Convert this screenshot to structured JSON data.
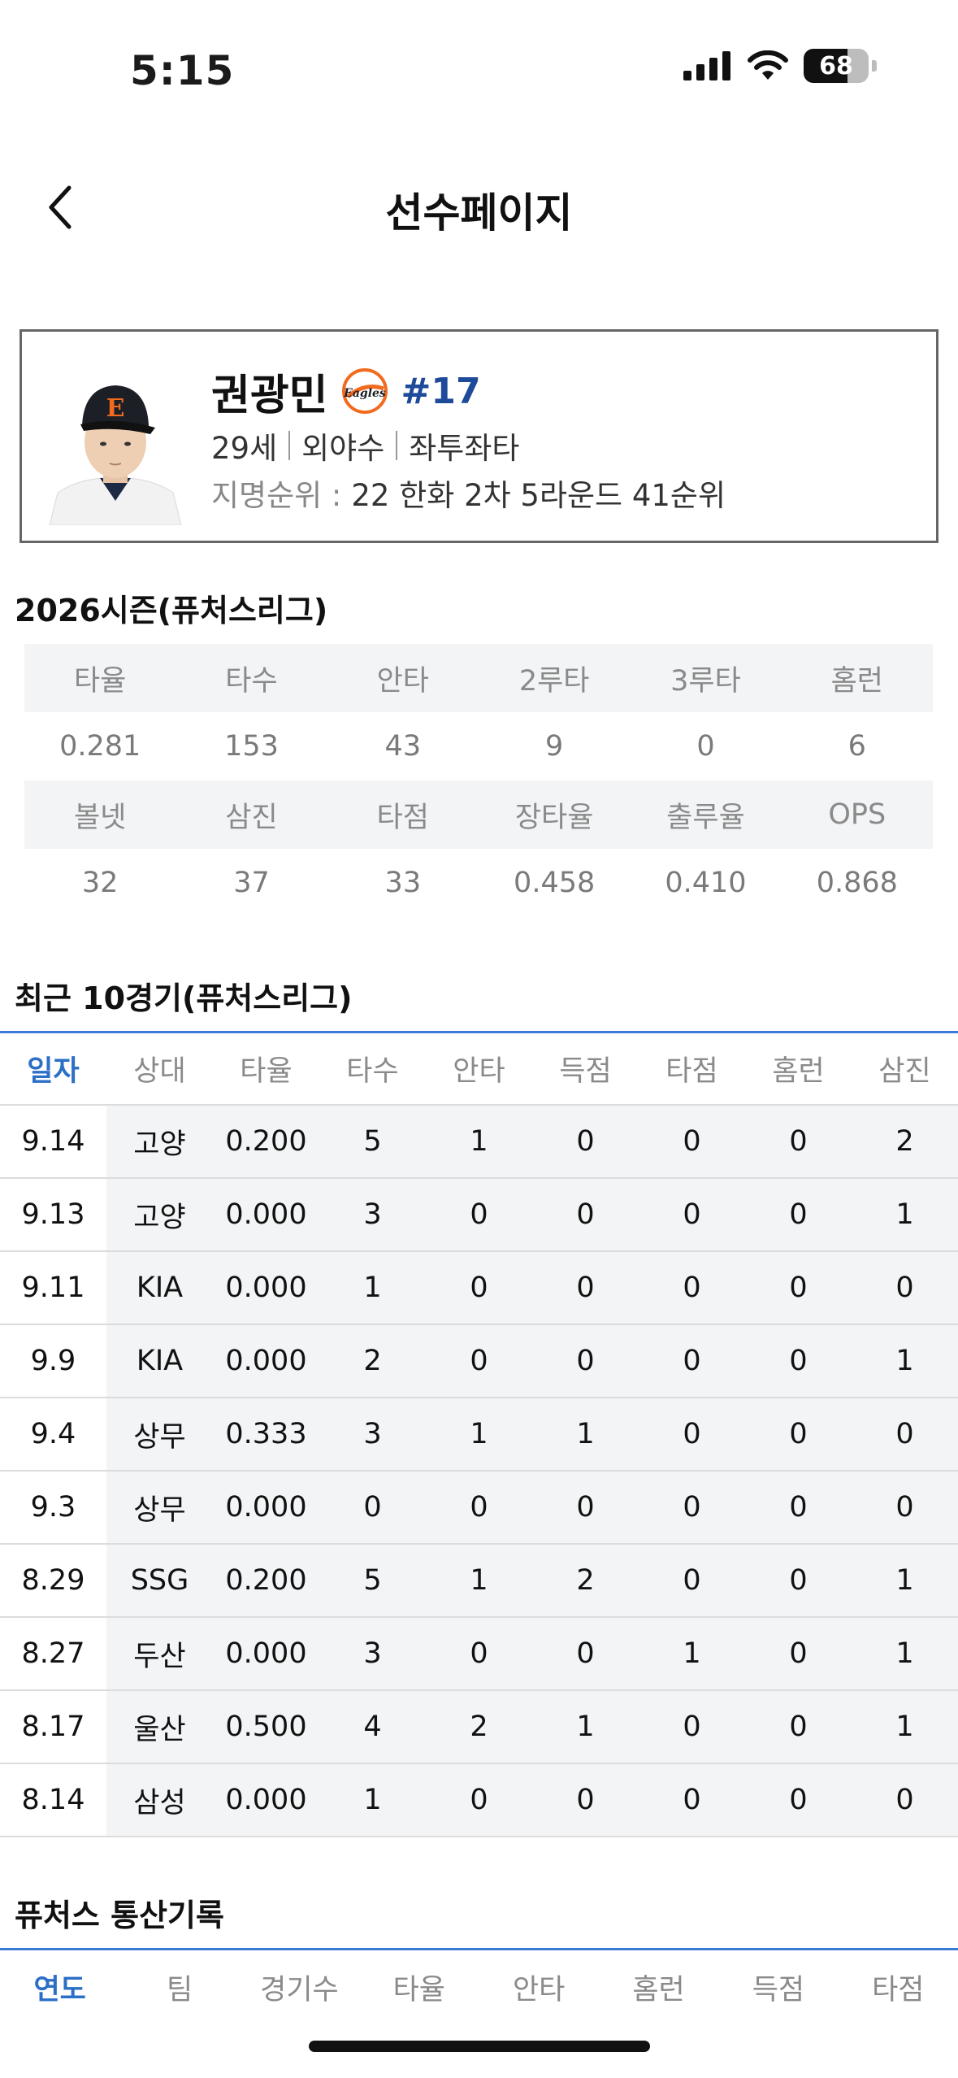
{
  "status": {
    "time": "5:15",
    "battery": "68",
    "battery_level": 0.68
  },
  "header": {
    "title": "선수페이지"
  },
  "player": {
    "name": "권광민",
    "number": "#17",
    "age": "29세",
    "position": "외야수",
    "bats_throws": "좌투좌타",
    "draft_label": "지명순위 :",
    "draft_value": "22 한화 2차 5라운드 41순위",
    "team_logo_text": "Eagles",
    "cap_letter": "E"
  },
  "season": {
    "title": "2026시즌(퓨처스리그)",
    "row1_headers": [
      "타율",
      "타수",
      "안타",
      "2루타",
      "3루타",
      "홈런"
    ],
    "row1_values": [
      "0.281",
      "153",
      "43",
      "9",
      "0",
      "6"
    ],
    "row2_headers": [
      "볼넷",
      "삼진",
      "타점",
      "장타율",
      "출루율",
      "OPS"
    ],
    "row2_values": [
      "32",
      "37",
      "33",
      "0.458",
      "0.410",
      "0.868"
    ]
  },
  "recent": {
    "title": "최근 10경기(퓨처스리그)",
    "headers": [
      "일자",
      "상대",
      "타율",
      "타수",
      "안타",
      "득점",
      "타점",
      "홈런",
      "삼진"
    ],
    "rows": [
      [
        "9.14",
        "고양",
        "0.200",
        "5",
        "1",
        "0",
        "0",
        "0",
        "2"
      ],
      [
        "9.13",
        "고양",
        "0.000",
        "3",
        "0",
        "0",
        "0",
        "0",
        "1"
      ],
      [
        "9.11",
        "KIA",
        "0.000",
        "1",
        "0",
        "0",
        "0",
        "0",
        "0"
      ],
      [
        "9.9",
        "KIA",
        "0.000",
        "2",
        "0",
        "0",
        "0",
        "0",
        "1"
      ],
      [
        "9.4",
        "상무",
        "0.333",
        "3",
        "1",
        "1",
        "0",
        "0",
        "0"
      ],
      [
        "9.3",
        "상무",
        "0.000",
        "0",
        "0",
        "0",
        "0",
        "0",
        "0"
      ],
      [
        "8.29",
        "SSG",
        "0.200",
        "5",
        "1",
        "2",
        "0",
        "0",
        "1"
      ],
      [
        "8.27",
        "두산",
        "0.000",
        "3",
        "0",
        "0",
        "1",
        "0",
        "1"
      ],
      [
        "8.17",
        "울산",
        "0.500",
        "4",
        "2",
        "1",
        "0",
        "0",
        "1"
      ],
      [
        "8.14",
        "삼성",
        "0.000",
        "1",
        "0",
        "0",
        "0",
        "0",
        "0"
      ]
    ]
  },
  "career": {
    "title": "퓨처스 통산기록",
    "headers": [
      "연도",
      "팀",
      "경기수",
      "타율",
      "안타",
      "홈런",
      "득점",
      "타점"
    ]
  }
}
